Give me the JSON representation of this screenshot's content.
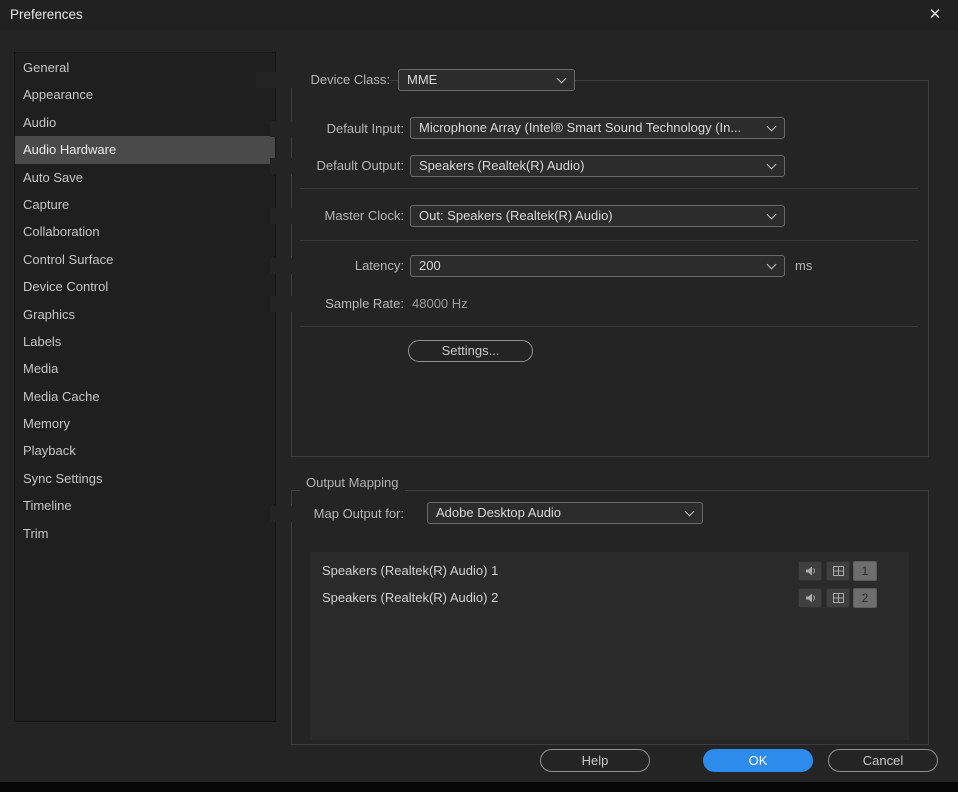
{
  "window": {
    "title": "Preferences"
  },
  "icons": {
    "close": "✕"
  },
  "sidebar": {
    "items": [
      {
        "label": "General",
        "selected": false
      },
      {
        "label": "Appearance",
        "selected": false
      },
      {
        "label": "Audio",
        "selected": false
      },
      {
        "label": "Audio Hardware",
        "selected": true
      },
      {
        "label": "Auto Save",
        "selected": false
      },
      {
        "label": "Capture",
        "selected": false
      },
      {
        "label": "Collaboration",
        "selected": false
      },
      {
        "label": "Control Surface",
        "selected": false
      },
      {
        "label": "Device Control",
        "selected": false
      },
      {
        "label": "Graphics",
        "selected": false
      },
      {
        "label": "Labels",
        "selected": false
      },
      {
        "label": "Media",
        "selected": false
      },
      {
        "label": "Media Cache",
        "selected": false
      },
      {
        "label": "Memory",
        "selected": false
      },
      {
        "label": "Playback",
        "selected": false
      },
      {
        "label": "Sync Settings",
        "selected": false
      },
      {
        "label": "Timeline",
        "selected": false
      },
      {
        "label": "Trim",
        "selected": false
      }
    ]
  },
  "panel": {
    "device_class": {
      "label": "Device Class:",
      "value": "MME"
    },
    "default_input": {
      "label": "Default Input:",
      "value": "Microphone Array (Intel® Smart Sound Technology (In..."
    },
    "default_output": {
      "label": "Default Output:",
      "value": "Speakers (Realtek(R) Audio)"
    },
    "master_clock": {
      "label": "Master Clock:",
      "value": "Out: Speakers (Realtek(R) Audio)"
    },
    "latency": {
      "label": "Latency:",
      "value": "200",
      "unit": "ms"
    },
    "sample_rate": {
      "label": "Sample Rate:",
      "value": "48000 Hz"
    },
    "settings_button": "Settings..."
  },
  "output_mapping": {
    "legend": "Output Mapping",
    "map_output_for": {
      "label": "Map Output for:",
      "value": "Adobe Desktop Audio"
    },
    "channels": [
      {
        "name": "Speakers (Realtek(R) Audio) 1",
        "number": "1"
      },
      {
        "name": "Speakers (Realtek(R) Audio) 2",
        "number": "2"
      }
    ]
  },
  "footer": {
    "help": "Help",
    "ok": "OK",
    "cancel": "Cancel"
  },
  "colors": {
    "accent": "#2d8ceb",
    "background": "#242424",
    "selection": "#4a4a4a"
  }
}
